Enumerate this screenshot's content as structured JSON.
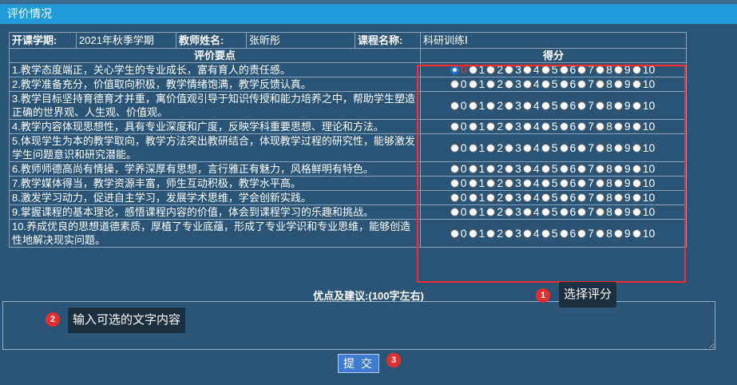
{
  "window": {
    "title": "评价情况"
  },
  "info": {
    "semester_label": "开课学期:",
    "semester_value": "2021年秋季学期",
    "teacher_label": "教师姓名:",
    "teacher_value": "张昕彤",
    "course_label": "课程名称:",
    "course_value": "科研训练Ⅰ"
  },
  "table_headers": {
    "criteria": "评价要点",
    "score": "得分"
  },
  "score_options": [
    "0",
    "1",
    "2",
    "3",
    "4",
    "5",
    "6",
    "7",
    "8",
    "9",
    "10"
  ],
  "criteria": [
    {
      "text": "1.教学态度端正，关心学生的专业成长，富有育人的责任感。",
      "selected": "0"
    },
    {
      "text": "2.教学准备充分，价值取向积极，教学情绪饱满，教学反馈认真。",
      "selected": null
    },
    {
      "text": "3.教学目标坚持育德育才并重，寓价值观引导于知识传授和能力培养之中，帮助学生塑造正确的世界观、人生观、价值观。",
      "selected": null
    },
    {
      "text": "4.教学内容体现思想性，具有专业深度和广度，反映学科重要思想、理论和方法。",
      "selected": null
    },
    {
      "text": "5.体现学生为本的教学取向，教学方法突出教研结合，体现教学过程的研究性，能够激发学生问题意识和研究潜能。",
      "selected": null
    },
    {
      "text": "6.教师师德高尚有情操，学养深厚有思想，言行雅正有魅力，风格鲜明有特色。",
      "selected": null
    },
    {
      "text": "7.教学媒体得当，教学资源丰富，师生互动积极，教学水平高。",
      "selected": null
    },
    {
      "text": "8.激发学习动力，促进自主学习，发展学术思维，学会创新实践。",
      "selected": null
    },
    {
      "text": "9.掌握课程的基本理论，感悟课程内容的价值，体会到课程学习的乐趣和挑战。",
      "selected": null
    },
    {
      "text": "10.养成优良的思想道德素质，厚植了专业底蕴，形成了专业学识和专业思维，能够创造性地解决现实问题。",
      "selected": null
    }
  ],
  "advice": {
    "title": "优点及建议:(100字左右)",
    "value": ""
  },
  "submit_label": "提 交",
  "annotations": [
    {
      "number": "1",
      "text": "选择评分"
    },
    {
      "number": "2",
      "text": "输入可选的文字内容"
    },
    {
      "number": "3",
      "text": ""
    }
  ],
  "colors": {
    "titlebar": "#1f9cd8",
    "background": "#2b5577",
    "highlight": "#ff2a2a",
    "button": "#3d7cd1"
  }
}
